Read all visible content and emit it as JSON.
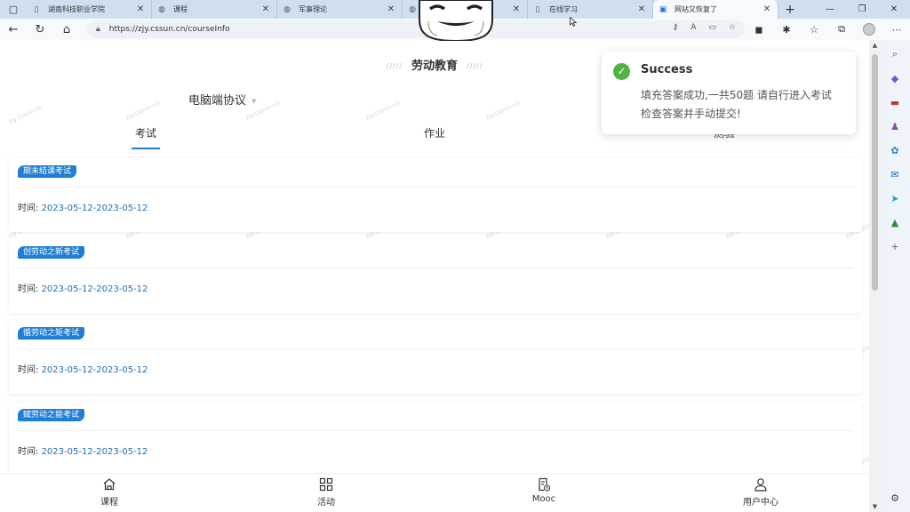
{
  "browser": {
    "tabs": [
      {
        "title": "湖南科技职业学院",
        "active": false
      },
      {
        "title": "课程",
        "active": false
      },
      {
        "title": "军事理论",
        "active": false
      },
      {
        "title": "",
        "active": false
      },
      {
        "title": "在线学习",
        "active": false
      },
      {
        "title": "网站又恢复了",
        "active": true
      }
    ],
    "url": "https://zjy.cssun.cn/courseInfo"
  },
  "page": {
    "title": "劳动教育",
    "title_dash": "/////",
    "protocol": "电脑端协议",
    "tabs": [
      "考试",
      "作业",
      "测验"
    ],
    "watermark": "zjy.cssun.cn",
    "time_label": "时间:",
    "items": [
      {
        "name": "期末结课考试",
        "time": "2023-05-12-2023-05-12"
      },
      {
        "name": "创劳动之新考试",
        "time": "2023-05-12-2023-05-12"
      },
      {
        "name": "循劳动之矩考试",
        "time": "2023-05-12-2023-05-12"
      },
      {
        "name": "赋劳动之能考试",
        "time": "2023-05-12-2023-05-12"
      }
    ],
    "bottom_nav": [
      "课程",
      "活动",
      "Mooc",
      "用户中心"
    ]
  },
  "toast": {
    "title": "Success",
    "message": "填充答案成功,一共50题 请自行进入考试检查答案并手动提交!"
  },
  "colors": {
    "accent": "#1f7fd6",
    "success": "#52b343"
  }
}
